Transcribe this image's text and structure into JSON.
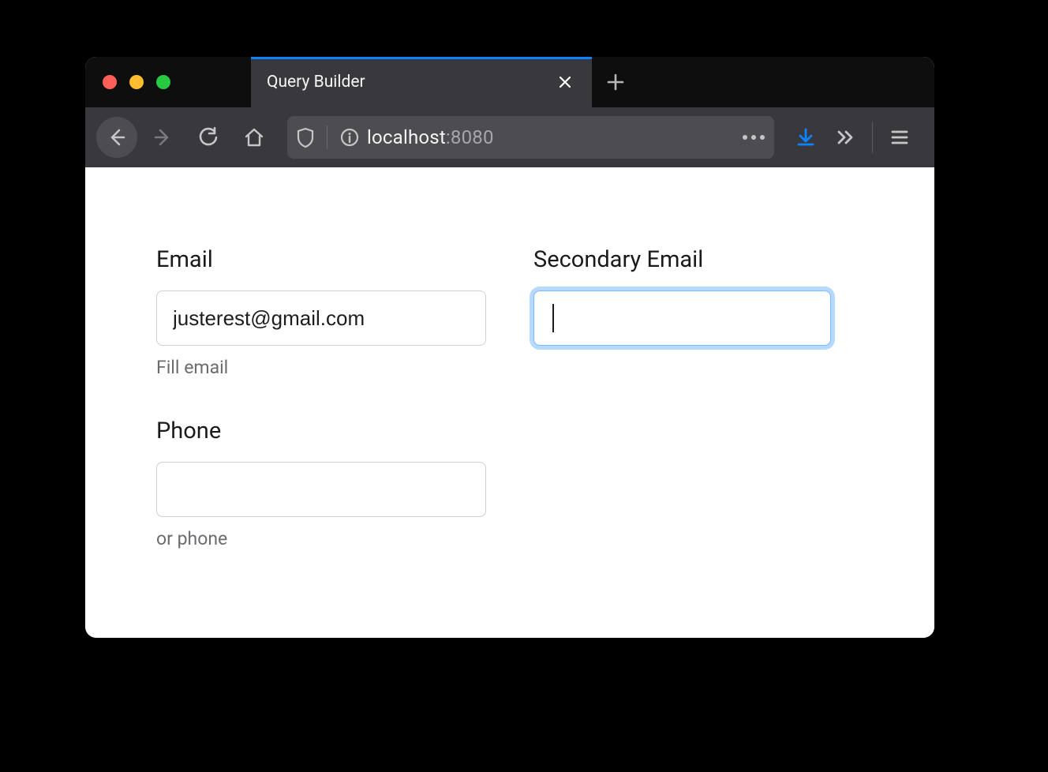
{
  "window": {
    "tab_title": "Query Builder"
  },
  "urlbar": {
    "host": "localhost",
    "port": ":8080"
  },
  "form": {
    "email": {
      "label": "Email",
      "value": "justerest@gmail.com",
      "hint": "Fill email"
    },
    "secondary_email": {
      "label": "Secondary Email",
      "value": ""
    },
    "phone": {
      "label": "Phone",
      "value": "",
      "hint": "or phone"
    }
  }
}
